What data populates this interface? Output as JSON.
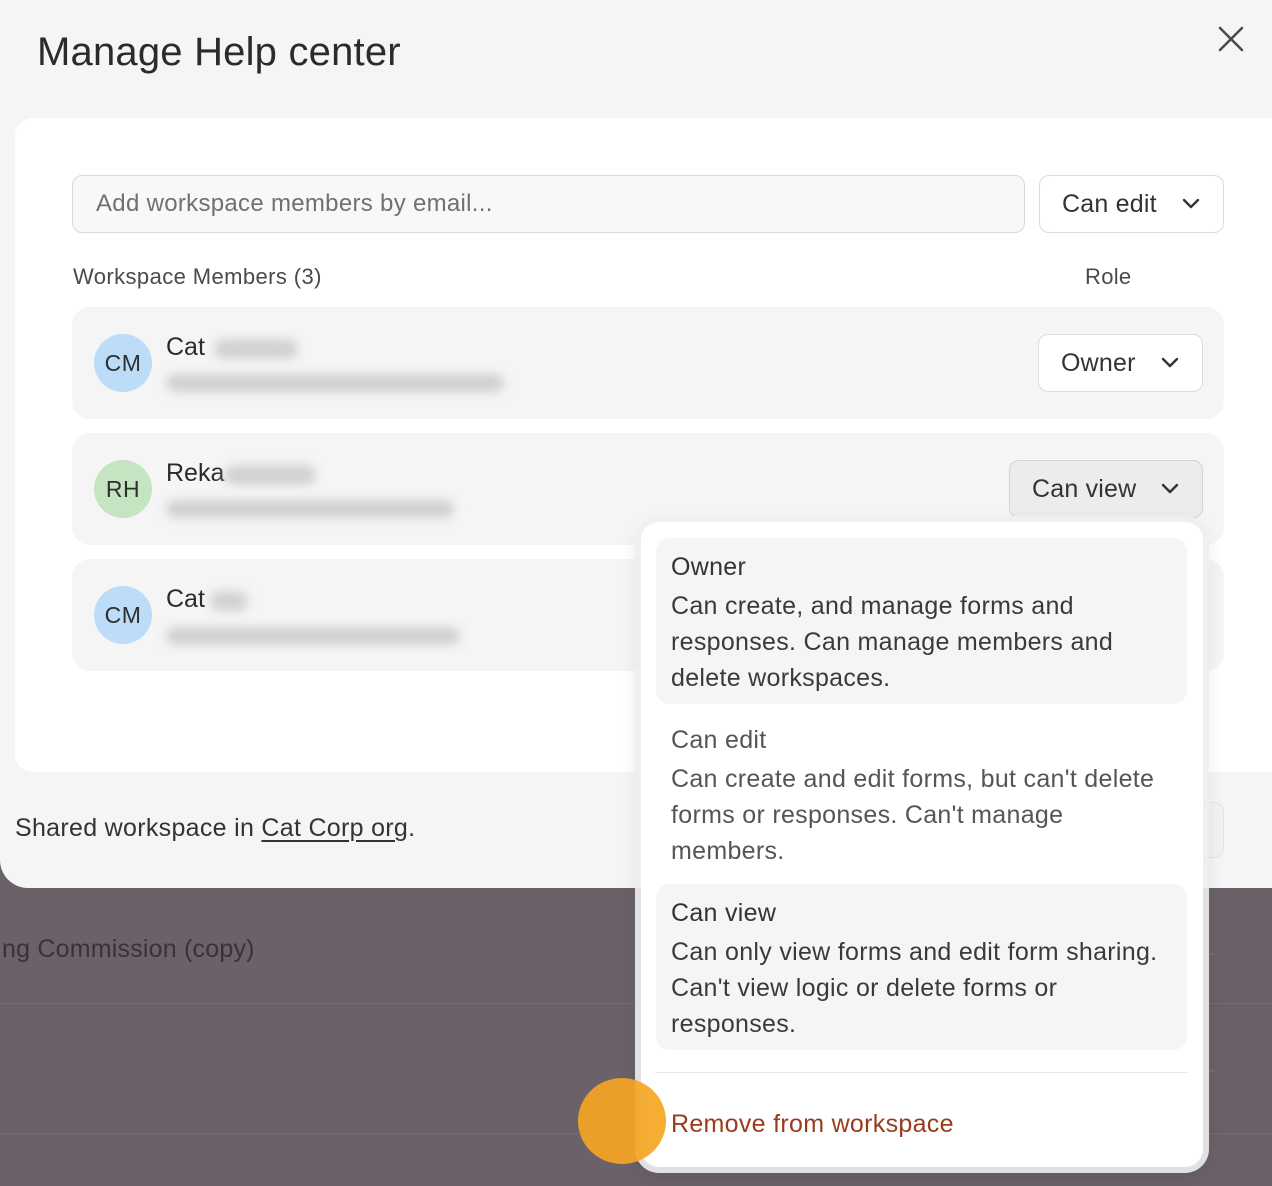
{
  "modal": {
    "title": "Manage Help center",
    "close_icon": "close-icon"
  },
  "invite": {
    "placeholder": "Add workspace members by email...",
    "role_select": "Can edit"
  },
  "members": {
    "heading": "Workspace Members (3)",
    "role_heading": "Role",
    "rows": [
      {
        "initials": "CM",
        "first_name": "Cat",
        "role": "Owner",
        "avatar_color": "#bcdcf8"
      },
      {
        "initials": "RH",
        "first_name": "Reka",
        "role": "Can view",
        "avatar_color": "#c5e4c2"
      },
      {
        "initials": "CM",
        "first_name": "Cat",
        "avatar_color": "#bcdcf8"
      }
    ]
  },
  "footer": {
    "prefix": "Shared workspace in ",
    "org_link": "Cat Corp org",
    "suffix": "."
  },
  "background": {
    "row_text": "ng Commission (copy)"
  },
  "dropdown": {
    "options": [
      {
        "title": "Owner",
        "description": "Can create, and manage forms and responses. Can manage members and delete workspaces."
      },
      {
        "title": "Can edit",
        "description": "Can create and edit forms, but can't delete forms or responses. Can't manage members."
      },
      {
        "title": "Can view",
        "description": "Can only view forms and edit form sharing. Can't view logic or delete forms or responses."
      }
    ],
    "remove_label": "Remove from workspace",
    "remove_color": "#9a3b1c"
  }
}
